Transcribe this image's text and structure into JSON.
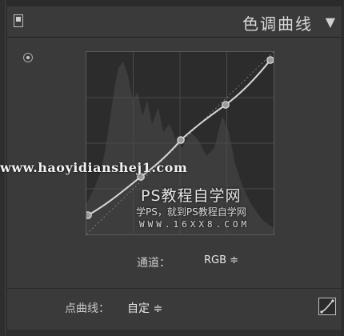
{
  "header": {
    "title": "色调曲线",
    "collapse_icon": "triangle-down-icon"
  },
  "tools": {
    "target_adjust_icon": "target-adjust-icon"
  },
  "watermark": {
    "url": "www.haoyidianshej1.com",
    "title": "PS教程自学网",
    "subtitle": "学PS，就到PS教程自学网",
    "site": "WWW.16XX8.COM"
  },
  "channel": {
    "label": "通道：",
    "value": "RGB ≑"
  },
  "point_curve": {
    "label": "点曲线：",
    "value": "自定 ≑"
  },
  "colors": {
    "panel_bg": "#3a3a3a",
    "graph_bg": "#2c2c2c",
    "curve": "#d9d9d9"
  }
}
